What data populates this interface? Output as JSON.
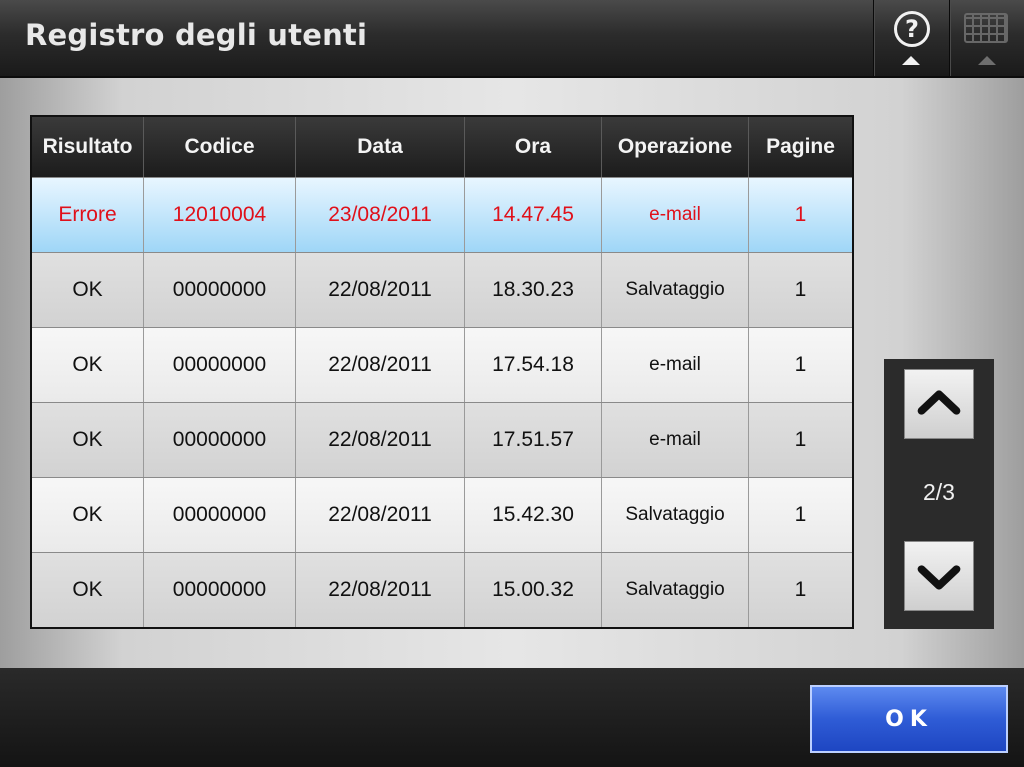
{
  "header": {
    "title": "Registro degli utenti",
    "help_icon": "help-icon",
    "keyboard_icon": "keyboard-icon"
  },
  "table": {
    "columns": [
      "Risultato",
      "Codice",
      "Data",
      "Ora",
      "Operazione",
      "Pagine"
    ],
    "rows": [
      {
        "result": "Errore",
        "code": "12010004",
        "date": "23/08/2011",
        "time": "14.47.45",
        "operation": "e-mail",
        "pages": "1",
        "selected": true
      },
      {
        "result": "OK",
        "code": "00000000",
        "date": "22/08/2011",
        "time": "18.30.23",
        "operation": "Salvataggio",
        "pages": "1"
      },
      {
        "result": "OK",
        "code": "00000000",
        "date": "22/08/2011",
        "time": "17.54.18",
        "operation": "e-mail",
        "pages": "1"
      },
      {
        "result": "OK",
        "code": "00000000",
        "date": "22/08/2011",
        "time": "17.51.57",
        "operation": "e-mail",
        "pages": "1"
      },
      {
        "result": "OK",
        "code": "00000000",
        "date": "22/08/2011",
        "time": "15.42.30",
        "operation": "Salvataggio",
        "pages": "1"
      },
      {
        "result": "OK",
        "code": "00000000",
        "date": "22/08/2011",
        "time": "15.00.32",
        "operation": "Salvataggio",
        "pages": "1"
      }
    ]
  },
  "pager": {
    "page_indicator": "2/3",
    "up_icon": "chevron-up-icon",
    "down_icon": "chevron-down-icon"
  },
  "footer": {
    "ok_label": "OK"
  },
  "colors": {
    "error_text": "#e0101a",
    "selected_row": "#9fd6f7",
    "ok_button": "#2f5cd6"
  }
}
